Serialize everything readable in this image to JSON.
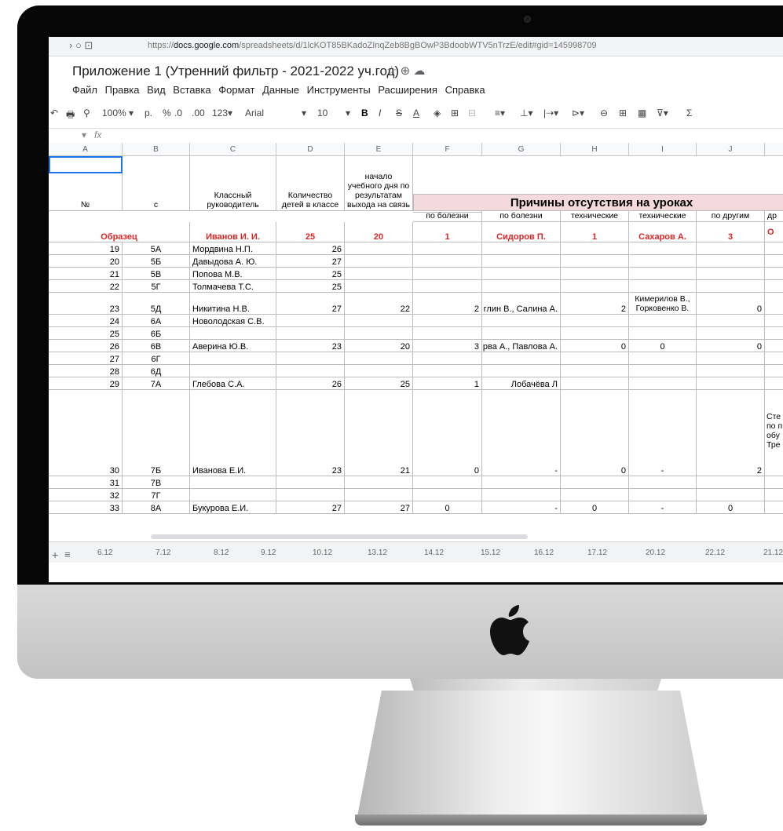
{
  "browser": {
    "nav": "›  ○   ⊡",
    "url_prefix": "https://",
    "url_host": "docs.google.com",
    "url_path": "/spreadsheets/d/1lcKOT85BKadoZInqZeb8BgBOwP3BdoobWTV5nTrzE/edit#gid=145998709"
  },
  "doc": {
    "title": "Приложение 1 (Утренний фильтр - 2021-2022 уч.год)",
    "icons": "☆ ⊕ ☁"
  },
  "menu": [
    "Файл",
    "Правка",
    "Вид",
    "Вставка",
    "Формат",
    "Данные",
    "Инструменты",
    "Расширения",
    "Справка"
  ],
  "toolbar": {
    "undo": "↶",
    "print": "🖶",
    "paint": "⚲",
    "zoom": "100% ▾",
    "currency": "р.",
    "percent": "%",
    "dec_minus": ".0",
    "dec_plus": ".00",
    "format": "123▾",
    "font": "Arial",
    "font_dd": "▾",
    "size": "10",
    "size_dd": "▾",
    "bold": "B",
    "italic": "I",
    "strike": "S",
    "textcolor": "A",
    "fill": "◈",
    "borders": "⊞",
    "merge": "⊟",
    "align": "≡▾",
    "valign": "⊥▾",
    "wrap": "|⇢▾",
    "rotate": "⊳▾",
    "link": "⊖",
    "comment": "⊞",
    "chart": "▦",
    "filter": "⊽▾",
    "func": "Σ"
  },
  "fx": {
    "ref": "▾",
    "label": "fx"
  },
  "columns": [
    "A",
    "B",
    "C",
    "D",
    "E",
    "F",
    "G",
    "H",
    "I",
    "J"
  ],
  "headers": {
    "num": "№",
    "cls": "с",
    "teacher": "Классный руководитель",
    "count": "Количество детей в классе",
    "start": "начало учебного дня по результатам выхода на связь",
    "group": "Причины отсутствия на уроках",
    "f": "по болезни",
    "g": "по болезни",
    "h": "технические",
    "i": "технические",
    "j": "по другим",
    "k": "др"
  },
  "sample": {
    "label": "Образец",
    "teacher": "Иванов И. И.",
    "count": "25",
    "start": "20",
    "f": "1",
    "g": "Сидоров П.",
    "h": "1",
    "i": "Сахаров А.",
    "j": "3",
    "k": "О"
  },
  "rows": [
    {
      "n": "19",
      "c": "5А",
      "t": "Мордвина Н.П.",
      "d": "26",
      "e": "",
      "f": "",
      "g": "",
      "h": "",
      "i": "",
      "j": ""
    },
    {
      "n": "20",
      "c": "5Б",
      "t": "Давыдова А. Ю.",
      "d": "27",
      "e": "",
      "f": "",
      "g": "",
      "h": "",
      "i": "",
      "j": ""
    },
    {
      "n": "21",
      "c": "5В",
      "t": "Попова М.В.",
      "d": "25",
      "e": "",
      "f": "",
      "g": "",
      "h": "",
      "i": "",
      "j": ""
    },
    {
      "n": "22",
      "c": "5Г",
      "t": "Толмачева Т.С.",
      "d": "25",
      "e": "",
      "f": "",
      "g": "",
      "h": "",
      "i": "",
      "j": ""
    },
    {
      "n": "23",
      "c": "5Д",
      "t": "Никитина Н.В.",
      "d": "27",
      "e": "22",
      "f": "2",
      "g": "глин В., Салина А.",
      "h": "2",
      "i": "Кимерилов В., Горковенко В.",
      "j": "0"
    },
    {
      "n": "24",
      "c": "6А",
      "t": "Новолодская С.В.",
      "d": "",
      "e": "",
      "f": "",
      "g": "",
      "h": "",
      "i": "",
      "j": ""
    },
    {
      "n": "25",
      "c": "6Б",
      "t": "",
      "d": "",
      "e": "",
      "f": "",
      "g": "",
      "h": "",
      "i": "",
      "j": ""
    },
    {
      "n": "26",
      "c": "6В",
      "t": "Аверина Ю.В.",
      "d": "23",
      "e": "20",
      "f": "3",
      "g": "рва А., Павлова А.",
      "h": "0",
      "i": "0",
      "j": "0"
    },
    {
      "n": "27",
      "c": "6Г",
      "t": "",
      "d": "",
      "e": "",
      "f": "",
      "g": "",
      "h": "",
      "i": "",
      "j": ""
    },
    {
      "n": "28",
      "c": "6Д",
      "t": "",
      "d": "",
      "e": "",
      "f": "",
      "g": "",
      "h": "",
      "i": "",
      "j": ""
    },
    {
      "n": "29",
      "c": "7А",
      "t": "Глебова С.А.",
      "d": "26",
      "e": "25",
      "f": "1",
      "g": "Лобачёва Л",
      "h": "",
      "i": "",
      "j": ""
    },
    {
      "n": "30",
      "c": "7Б",
      "t": "Иванова Е.И.",
      "d": "23",
      "e": "21",
      "f": "0",
      "g": "-",
      "h": "0",
      "i": "-",
      "j": "2"
    },
    {
      "n": "31",
      "c": "7В",
      "t": "",
      "d": "",
      "e": "",
      "f": "",
      "g": "",
      "h": "",
      "i": "",
      "j": ""
    },
    {
      "n": "32",
      "c": "7Г",
      "t": "",
      "d": "",
      "e": "",
      "f": "",
      "g": "",
      "h": "",
      "i": "",
      "j": ""
    },
    {
      "n": "33",
      "c": "8А",
      "t": "Букурова Е.И.",
      "d": "27",
      "e": "27",
      "f": "0",
      "g": "-",
      "h": "0",
      "i": "-",
      "j": "0"
    }
  ],
  "overflow_note": "Сте по п обу Тре",
  "tabs": [
    "6.12",
    "7.12",
    "8.12",
    "9.12",
    "10.12",
    "13.12",
    "14.12",
    "15.12",
    "16.12",
    "17.12",
    "20.12",
    "22.12",
    "21.12"
  ]
}
